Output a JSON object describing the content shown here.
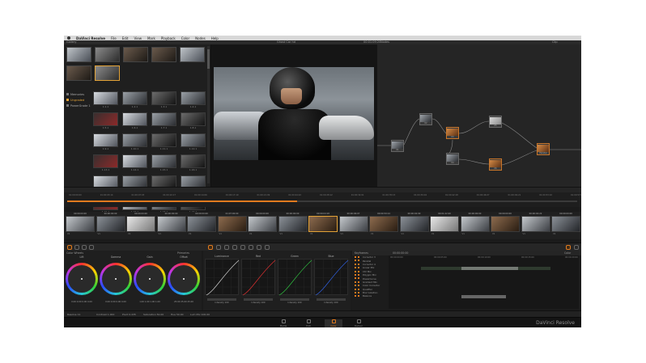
{
  "menubar": {
    "app_name": "DaVinci Resolve",
    "items": [
      "File",
      "Edit",
      "View",
      "Mark",
      "Playback",
      "Color",
      "Nodes",
      "Help"
    ]
  },
  "topbar": {
    "gallery_label": "Gallery",
    "viewer_title": "Ghost Car hd",
    "viewer_timecode": "00:01:09:20",
    "nodes_label": "Nodes",
    "clip_label": "Clip"
  },
  "gallery": {
    "albums": [
      {
        "label": "Memories"
      },
      {
        "label": "Ungraded"
      },
      {
        "label": "PowerGrade 1"
      }
    ],
    "grid_labels": [
      "1.1.1",
      "1.2.1",
      "1.3.1",
      "1.4.1",
      "1.5.1",
      "1.6.1",
      "1.7.1",
      "1.8.1",
      "1.9.1",
      "1.10.1",
      "1.11.1",
      "1.12.1",
      "1.13.1",
      "1.14.1",
      "1.15.1",
      "1.16.1",
      "1.17.1",
      "1.18.1",
      "1.19.1",
      "1.20.1",
      "1.21.1",
      "1.22.1",
      "1.23.1",
      "1.24.1"
    ]
  },
  "viewer": {
    "transport_timecode": "01:01:09:20"
  },
  "nodes": [
    {
      "label": "01"
    },
    {
      "label": "02"
    },
    {
      "label": "03"
    },
    {
      "label": "04"
    },
    {
      "label": "05"
    },
    {
      "label": "06"
    },
    {
      "label": "Parallel"
    }
  ],
  "timeline": {
    "ruler_ticks": [
      "01:00:00:00",
      "01:00:03:14",
      "01:00:07:03",
      "01:00:10:17",
      "01:00:14:06",
      "01:00:17:19",
      "01:00:21:09",
      "01:00:24:22",
      "01:00:28:12",
      "01:00:32:01",
      "01:00:35:15",
      "01:00:39:04",
      "01:00:42:18",
      "01:00:46:07",
      "01:00:49:21",
      "01:00:53:10",
      "01:00:57:00"
    ],
    "playhead_fraction": 0.45,
    "clips": [
      {
        "tc": "00:00:00:00",
        "label": "V1"
      },
      {
        "tc": "00:00:00:00",
        "label": "V1"
      },
      {
        "tc": "00:00:00:00",
        "label": "V1"
      },
      {
        "tc": "00:00:00:00",
        "label": "V1"
      },
      {
        "tc": "00:00:00:00",
        "label": "V1"
      },
      {
        "tc": "01:07:00:00",
        "label": "V1"
      },
      {
        "tc": "00:00:00:00",
        "label": "V1"
      },
      {
        "tc": "00:00:00:00",
        "label": "V1"
      },
      {
        "tc": "00:00:04:18",
        "label": "V1"
      },
      {
        "tc": "00:00:06:07",
        "label": "V1"
      },
      {
        "tc": "00:04:59:14",
        "label": "V1"
      },
      {
        "tc": "00:00:02:09",
        "label": "V1"
      },
      {
        "tc": "00:01:22:20",
        "label": "V1"
      },
      {
        "tc": "00:00:00:00",
        "label": "V1"
      },
      {
        "tc": "00:00:00:00",
        "label": "V1"
      },
      {
        "tc": "00:00:02:22",
        "label": "V1"
      },
      {
        "tc": "00:00:00:00",
        "label": "V1"
      }
    ]
  },
  "color_wheels": {
    "title": "Color Wheels",
    "mode": "Primaries",
    "wheels": [
      {
        "label": "Lift",
        "values": "0.00  0.00  0.00  0.00"
      },
      {
        "label": "Gamma",
        "values": "0.00  0.00  0.00  0.00"
      },
      {
        "label": "Gain",
        "values": "1.00  1.00  1.00  1.00"
      },
      {
        "label": "Offset",
        "values": "25.00  25.00  25.00"
      }
    ]
  },
  "curves": {
    "title": "Curves",
    "channels": [
      {
        "label": "Luminance",
        "intensity": "Intensity 100",
        "color": "#d0d0d0"
      },
      {
        "label": "Red",
        "intensity": "Intensity 100",
        "color": "#e03030"
      },
      {
        "label": "Green",
        "intensity": "Intensity 100",
        "color": "#30c040"
      },
      {
        "label": "Blue",
        "intensity": "Intensity 100",
        "color": "#3060e0"
      }
    ]
  },
  "keyframes": {
    "title": "Keyframes",
    "timecode": "00:00:00:00",
    "mode": "Color",
    "ticks": [
      "00:00:00:00",
      "00:00:05:00",
      "00:00:10:00",
      "00:00:15:00",
      "00:00:20:00"
    ],
    "rows": [
      "Corrector 3",
      "Parallel",
      "Corrector 4",
      "Linear Mix",
      "Ctrl Mix",
      "Polygon Mix",
      "PowerCurve",
      "Gradient Mix",
      "Color Corrector",
      "Qualifier",
      "Blur Isolation",
      "Balance"
    ]
  },
  "statusbar": {
    "contrast": "Contrast 1.000",
    "pivot": "Pivot 0.435",
    "saturation": "Saturation 50.00",
    "hue": "Hue 50.00",
    "lum_mix": "Lum Mix 100.00",
    "resolve": "Resolve 11"
  },
  "pages": [
    {
      "label": "Media"
    },
    {
      "label": "Edit"
    },
    {
      "label": "Color"
    },
    {
      "label": "Deliver"
    }
  ],
  "brand": "DaVinci Resolve",
  "accent_color": "#e07a1f"
}
